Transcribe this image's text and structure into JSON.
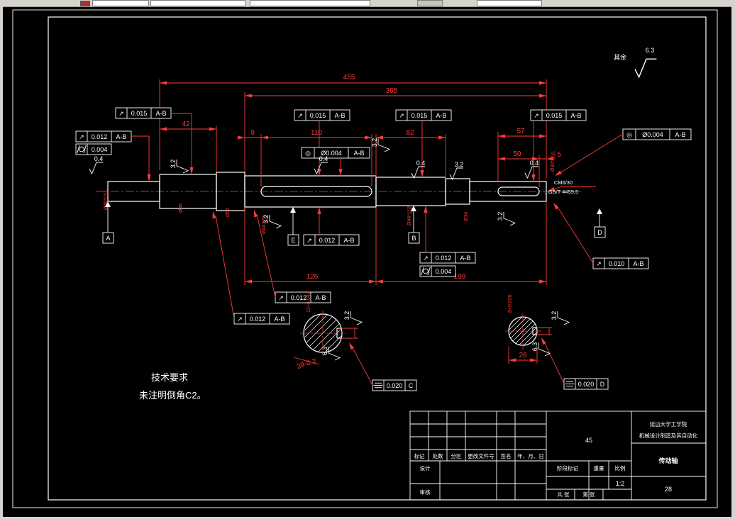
{
  "note": {
    "label": "其余",
    "value": "6.3"
  },
  "tech": {
    "line1": "技术要求",
    "line2": "未注明倒角C2。"
  },
  "dims": {
    "total": "455",
    "span365": "365",
    "d42": "42",
    "d9": "9",
    "d110": "110",
    "d82": "82",
    "d57": "57",
    "d50": "50",
    "d5": "5",
    "d126": "126",
    "d199": "199",
    "sec_left": "39-0.2",
    "sec_right": "28",
    "kw_left": "12+0.043",
    "kw_right": "8+0.036"
  },
  "dia": {
    "d1": "Ø40",
    "d1u": "+0.018",
    "d1l": "+0.002",
    "d2": "Ø46",
    "d3": "Ø50",
    "d4": "Ø44",
    "d4u": "-0.009",
    "d4l": "-0.025",
    "d5": "Ø44",
    "d5u": "+0.018",
    "d5l": "+0.002",
    "d6": "Ø34",
    "d7": "Ø30",
    "d7u": "+0.015",
    "d7l": "+0.002"
  },
  "rough": {
    "r04": "0.4",
    "r32": "3.2",
    "r63": "6.3"
  },
  "sym": {
    "runout": "↗",
    "conc": "◎"
  },
  "fcf": {
    "v015": "0.015",
    "v012": "0.012",
    "v010": "0.010",
    "v004": "0.004",
    "vd004": "Ø0.004",
    "v020": "0.020",
    "ab": "A-B",
    "c": "C",
    "d": "D"
  },
  "datum": {
    "a": "A",
    "b": "B",
    "d": "D",
    "e": "E"
  },
  "chole": {
    "line1": "CM6/30",
    "line2": "GB/T 4459.5"
  },
  "tb": {
    "material": "45",
    "school1": "延边大学工学院",
    "school2": "机械设计制造及其自动化",
    "part": "传动轴",
    "num": "28",
    "scale": "1:2",
    "h_mark": "标记",
    "h_count": "处数",
    "h_zone": "分区",
    "h_doc": "更改文件号",
    "h_sign": "签名",
    "h_date": "年、月、日",
    "r_design": "设计",
    "r_check": "审核",
    "l_stage": "阶段标记",
    "l_weight": "重量",
    "l_scale": "比例",
    "b_sheet1": "共 张",
    "b_sheet2": "第 张"
  }
}
